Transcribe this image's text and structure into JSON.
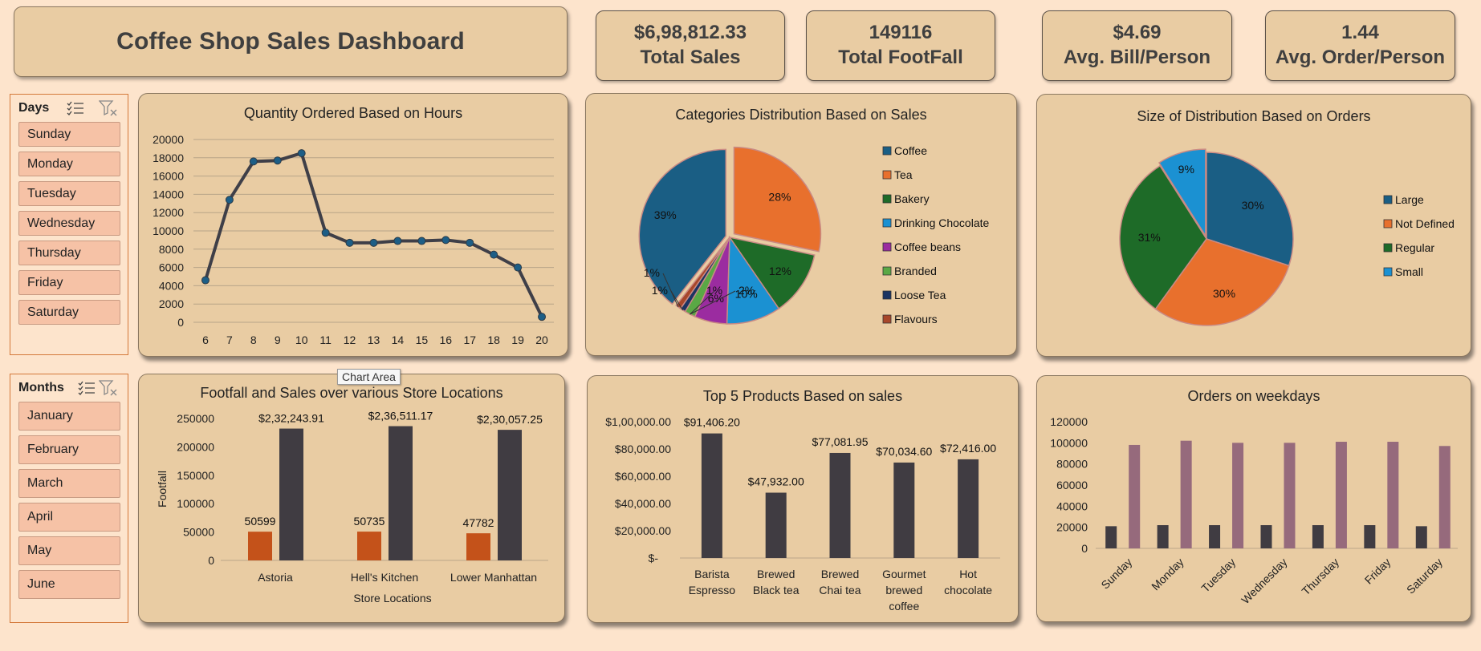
{
  "dashboard": {
    "title": "Coffee Shop Sales Dashboard"
  },
  "kpis": [
    {
      "value": "$6,98,812.33",
      "label": "Total Sales"
    },
    {
      "value": "149116",
      "label": "Total FootFall"
    },
    {
      "value": "$4.69",
      "label": "Avg. Bill/Person"
    },
    {
      "value": "1.44",
      "label": "Avg. Order/Person"
    }
  ],
  "days_slicer": {
    "title": "Days",
    "items": [
      "Sunday",
      "Monday",
      "Tuesday",
      "Wednesday",
      "Thursday",
      "Friday",
      "Saturday"
    ]
  },
  "months_slicer": {
    "title": "Months",
    "items": [
      "January",
      "February",
      "March",
      "April",
      "May",
      "June"
    ]
  },
  "tooltip": {
    "text": "Chart Area"
  },
  "colors": {
    "page_bg": "#fde4cc",
    "panel_bg": "#e9cca3",
    "dark_bar": "#403c42",
    "orange_bar": "#c4521a",
    "purple_bar": "#966a7c",
    "line": "#3f3f48",
    "marker": "#1d5e86"
  },
  "chart_data": [
    {
      "type": "line",
      "title": "Quantity Ordered Based on Hours",
      "x": [
        6,
        7,
        8,
        9,
        10,
        11,
        12,
        13,
        14,
        15,
        16,
        17,
        18,
        19,
        20
      ],
      "values": [
        4600,
        13400,
        17600,
        17700,
        18500,
        9800,
        8700,
        8700,
        8900,
        8900,
        9000,
        8700,
        7400,
        6000,
        600
      ],
      "ylim": [
        0,
        20000
      ],
      "yticks": [
        "20000",
        "18000",
        "16000",
        "14000",
        "12000",
        "10000",
        "8000",
        "6000",
        "4000",
        "2000",
        "0"
      ],
      "grid": true
    },
    {
      "type": "pie",
      "title": "Categories Distribution Based on Sales",
      "labels": [
        "Coffee",
        "Tea",
        "Bakery",
        "Drinking Chocolate",
        "Coffee beans",
        "Branded",
        "Loose Tea",
        "Flavours"
      ],
      "values": [
        39,
        28,
        12,
        10,
        6,
        2,
        1,
        1
      ],
      "data_labels": [
        "39%",
        "28%",
        "12%",
        "10%",
        "6%",
        "2%",
        "1%",
        "1%",
        "1%"
      ],
      "colors": [
        "#1a5e84",
        "#e8702d",
        "#1e6b28",
        "#1b91d2",
        "#9b2ca0",
        "#5aa845",
        "#1c3462",
        "#a8472a"
      ],
      "legend": "right"
    },
    {
      "type": "pie",
      "title": "Size of Distribution Based on Orders",
      "labels": [
        "Large",
        "Not Defined",
        "Regular",
        "Small"
      ],
      "values": [
        30,
        30,
        31,
        9
      ],
      "data_labels": [
        "30%",
        "30%",
        "31%",
        "9%"
      ],
      "colors": [
        "#1a5e84",
        "#e8702d",
        "#1e6b28",
        "#1b91d2"
      ],
      "legend": "right"
    },
    {
      "type": "bar",
      "title": "Footfall and Sales over various Store Locations",
      "categories": [
        "Astoria",
        "Hell's Kitchen",
        "Lower Manhattan"
      ],
      "series": [
        {
          "values": [
            50599,
            50735,
            47782
          ],
          "data_labels": [
            "50599",
            "50735",
            "47782"
          ]
        },
        {
          "values": [
            232243.91,
            236511.17,
            230057.25
          ],
          "data_labels": [
            "$2,32,243.91",
            "$2,36,511.17",
            "$2,30,057.25"
          ]
        }
      ],
      "ylabel": "Footfall",
      "xlabel": "Store Locations",
      "ylim": [
        0,
        250000
      ],
      "yticks": [
        "250000",
        "200000",
        "150000",
        "100000",
        "50000",
        "0"
      ]
    },
    {
      "type": "bar",
      "title": "Top 5 Products Based on sales",
      "categories": [
        [
          "Barista",
          "Espresso"
        ],
        [
          "Brewed",
          "Black tea"
        ],
        [
          "Brewed",
          "Chai tea"
        ],
        [
          "Gourmet",
          "brewed",
          "coffee"
        ],
        [
          "Hot",
          "chocolate"
        ]
      ],
      "values": [
        91406.2,
        47932.0,
        77081.95,
        70034.6,
        72416.0
      ],
      "data_labels": [
        "$91,406.20",
        "$47,932.00",
        "$77,081.95",
        "$70,034.60",
        "$72,416.00"
      ],
      "ylim": [
        0,
        100000
      ],
      "yticks": [
        "$1,00,000.00",
        "$80,000.00",
        "$60,000.00",
        "$40,000.00",
        "$20,000.00",
        "$-"
      ]
    },
    {
      "type": "bar",
      "title": "Orders on weekdays",
      "categories": [
        "Sunday",
        "Monday",
        "Tuesday",
        "Wednesday",
        "Thursday",
        "Friday",
        "Saturday"
      ],
      "series": [
        {
          "values": [
            21000,
            22000,
            22000,
            22000,
            22000,
            22000,
            21000
          ]
        },
        {
          "values": [
            98000,
            102000,
            100000,
            100000,
            101000,
            101000,
            97000
          ]
        }
      ],
      "ylim": [
        0,
        120000
      ],
      "yticks": [
        "120000",
        "100000",
        "80000",
        "60000",
        "40000",
        "20000",
        "0"
      ]
    }
  ]
}
